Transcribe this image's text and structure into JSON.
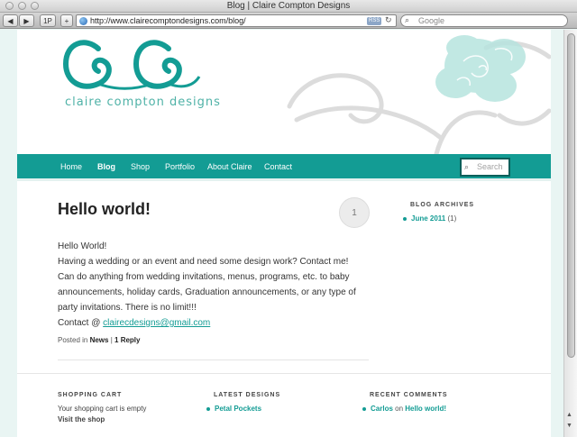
{
  "window": {
    "title": "Blog | Claire Compton Designs"
  },
  "toolbar": {
    "back_label": "◀",
    "forward_label": "▶",
    "topsites_label": "1P",
    "add_label": "+",
    "url": "http://www.clairecomptondesigns.com/blog/",
    "rss_label": "RSS",
    "search_placeholder": "Google"
  },
  "site": {
    "logo_text": "claire compton designs",
    "nav": [
      {
        "label": "Home"
      },
      {
        "label": "Blog"
      },
      {
        "label": "Shop"
      },
      {
        "label": "Portfolio"
      },
      {
        "label": "About Claire"
      },
      {
        "label": "Contact"
      }
    ],
    "search_placeholder": "Search"
  },
  "post": {
    "title": "Hello world!",
    "comment_count": "1",
    "lines": [
      "Hello World!",
      "Having a wedding or an event and need some design work? Contact me!",
      "Can do anything from wedding invitations, menus, programs, etc. to baby announcements, holiday cards, Graduation announcements, or any type of party invitations. There is no limit!!!"
    ],
    "contact_prefix": "Contact @ ",
    "contact_email": "clairecdesigns@gmail.com",
    "meta_prefix": "Posted in ",
    "category": "News",
    "meta_sep": " | ",
    "replies": "1 Reply"
  },
  "sidebar": {
    "archives_heading": "BLOG ARCHIVES",
    "archive_month": "June 2011",
    "archive_count": "(1)"
  },
  "footer": {
    "cart_heading": "SHOPPING CART",
    "cart_status": "Your shopping cart is empty",
    "visit_shop": "Visit the shop",
    "designs_heading": "LATEST DESIGNS",
    "design_item": "Petal Pockets",
    "comments_heading": "RECENT COMMENTS",
    "comment_author": "Carlos",
    "comment_on": " on ",
    "comment_post": "Hello world!"
  },
  "colors": {
    "accent": "#139c94",
    "logo": "#4fb2a7",
    "background": "#e9f5f3"
  }
}
